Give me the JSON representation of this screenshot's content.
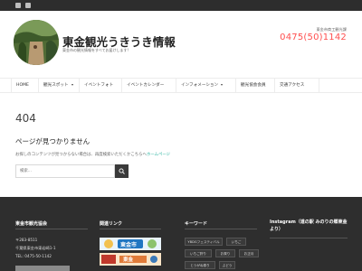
{
  "header": {
    "site_title": "東金観光うきうき情報",
    "tagline": "東金市の観光情報をすべてお届けします!",
    "contact_label": "東金市商工観光課",
    "contact_phone": "0475(50)1142",
    "accent_color": "#ff4f4f"
  },
  "nav": {
    "items": [
      {
        "label": "HOME",
        "dropdown": false
      },
      {
        "label": "観光スポット",
        "dropdown": true
      },
      {
        "label": "イベントフォト",
        "dropdown": false
      },
      {
        "label": "イベントカレンダー",
        "dropdown": false
      },
      {
        "label": "インフォメーション",
        "dropdown": true
      },
      {
        "label": "観光協会会員",
        "dropdown": false
      },
      {
        "label": "交通アクセス",
        "dropdown": false
      }
    ]
  },
  "error": {
    "code": "404",
    "title": "ページが見つかりません",
    "message": "お探しのコンテンツが見つからない場合は、再度検索いただくかこちらへ",
    "home_link": "ホームページ",
    "search_placeholder": "検索...",
    "link_color": "#2ab3a0"
  },
  "footer": {
    "col1": {
      "title": "東金市観光協会",
      "postal": "〒283-8511",
      "address": "千葉県東金市東岩崎1-1",
      "tel": "TEL: 0475-50-1142"
    },
    "col2": {
      "title": "関連リンク",
      "banner1": "東金市",
      "banner2": "東金"
    },
    "col3": {
      "title": "キーワード",
      "tags": [
        "YBDGフェスティバル",
        "いちご",
        "いちご狩り",
        "お祭り",
        "お正月",
        "とうがね祭り",
        "ぶどう"
      ]
    },
    "col4": {
      "title": "Instagram（道の駅 みのりの郷東金より）"
    }
  }
}
